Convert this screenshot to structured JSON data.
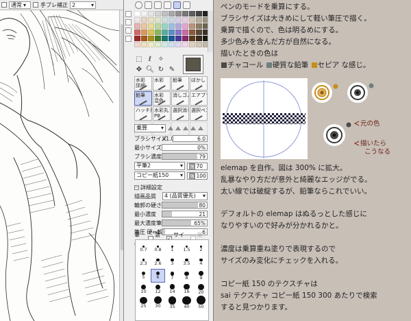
{
  "toolbar": {
    "mode_label": "通常",
    "stabilizer_label": "手ブレ補正",
    "stabilizer_value": "2"
  },
  "colors": {
    "preview_fg": "#59564a",
    "charcoal": "#4a4a48",
    "hard_pencil": "#6e7f7e",
    "sepia": "#c58f17",
    "active_highlight": "#cfd8f3",
    "preview_line": "#8e9ad8"
  },
  "brushes": [
    {
      "label": "水彩\n詳細",
      "active": false
    },
    {
      "label": "水彩",
      "active": false
    },
    {
      "label": "鉛筆",
      "active": false
    },
    {
      "label": "ぼかし",
      "active": false
    },
    {
      "label": "鉛筆",
      "active": true
    },
    {
      "label": "水彩\n混色",
      "active": false
    },
    {
      "label": "消しゴム",
      "active": false
    },
    {
      "label": "エアブラシ",
      "active": false
    },
    {
      "label": "ハッチ用",
      "active": false
    },
    {
      "label": "水彩丸\nPB",
      "active": false
    },
    {
      "label": "選択消し",
      "active": false
    },
    {
      "label": "選択ペン",
      "active": false
    }
  ],
  "brush_settings": {
    "blend_mode": "乗算",
    "size_label": "ブラシサイズ",
    "size_multiplier": "×1.0",
    "size_value": "6.0",
    "min_size_label": "最小サイズ",
    "min_size_value": "0%",
    "min_size_fill": 0.0,
    "density_label": "ブラシ濃度",
    "density_value": "79",
    "density_fill": 0.79,
    "shape_select": "平筆2",
    "shape_badge": "強",
    "shape_value": "70",
    "texture_select": "コピー紙150",
    "texture_badge": "強",
    "texture_value": "100"
  },
  "detail_settings": {
    "header": "詳細設定",
    "quality_label": "描画品質",
    "quality_value": "4 (品質優先)",
    "hardness_label": "輪郭の硬さ",
    "hardness_value": "80",
    "hardness_fill": 0.8,
    "min_density_label": "最小濃度",
    "min_density_value": "21",
    "min_density_fill": 0.21,
    "max_density_pressure_label": "最大濃度筆圧",
    "max_density_pressure_value": "65%",
    "max_density_pressure_fill": 0.65,
    "pressure_label": "筆圧 硬⇔軟",
    "pressure_value": "6",
    "pressure_fill": 0.06,
    "pressure_opts_label": "筆圧:",
    "opt_density": "濃度",
    "opt_size": "サイズ",
    "opt_blend": "混色"
  },
  "size_presets": [
    {
      "label": "0.7",
      "value": 0.7
    },
    {
      "label": "0.8",
      "value": 0.8
    },
    {
      "label": "1",
      "value": 1
    },
    {
      "label": "1.5",
      "value": 1.5
    },
    {
      "label": "2",
      "value": 2
    },
    {
      "label": "2.3",
      "value": 2.3
    },
    {
      "label": "2.6",
      "value": 2.6
    },
    {
      "label": "3",
      "value": 3
    },
    {
      "label": "3.5",
      "value": 3.5
    },
    {
      "label": "4",
      "value": 4
    },
    {
      "label": "5",
      "value": 5
    },
    {
      "label": "6",
      "value": 6
    },
    {
      "label": "7",
      "value": 7
    },
    {
      "label": "8",
      "value": 8
    },
    {
      "label": "9",
      "value": 9
    },
    {
      "label": "10",
      "value": 10
    },
    {
      "label": "12",
      "value": 12
    },
    {
      "label": "14",
      "value": 14
    },
    {
      "label": "16",
      "value": 16
    },
    {
      "label": "20",
      "value": 20
    },
    {
      "label": "25",
      "value": 25
    },
    {
      "label": "30",
      "value": 30
    },
    {
      "label": "35",
      "value": 35
    },
    {
      "label": "40",
      "value": 40
    },
    {
      "label": "50",
      "value": 50
    }
  ],
  "active_size": "6",
  "notes": {
    "line1": "ペンのモードを乗算にする。",
    "line2": "ブラシサイズは大きめにして軽い筆圧で描く。",
    "line3": "乗算で描くので、色は明るめにする。",
    "line4": "多少色みを含んだ方が自然になる。",
    "line5": "描いたときの色は",
    "legend_charcoal": "チャコール",
    "legend_pencil": "硬質な鉛筆",
    "legend_sepia": "セピア",
    "legend_suffix": "な感じ。",
    "annotation_original": "元の色",
    "annotation_drawn_1": "描いたら",
    "annotation_drawn_2": "こうなる",
    "line6": "elemap を自作。図は 300% に拡大。",
    "line7": "乱暴なやり方だが意外と綺麗なエッジがでる。",
    "line8": "太い線では破綻するが、鉛筆ならこれでいい。",
    "line9": "デフォルトの elemap はぬるっとした感じに",
    "line10": "なりやすいので好みが分かれるかと。",
    "line11": "濃度は乗算重ね塗りで表現するので",
    "line12": "サイズのみ変化にチェックを入れる。",
    "line13": "コピー紙 150 のテクスチャは",
    "line14": "sai テクスチャ コピー紙 150 300 あたりで検索",
    "line15": "すると見つかります。"
  }
}
